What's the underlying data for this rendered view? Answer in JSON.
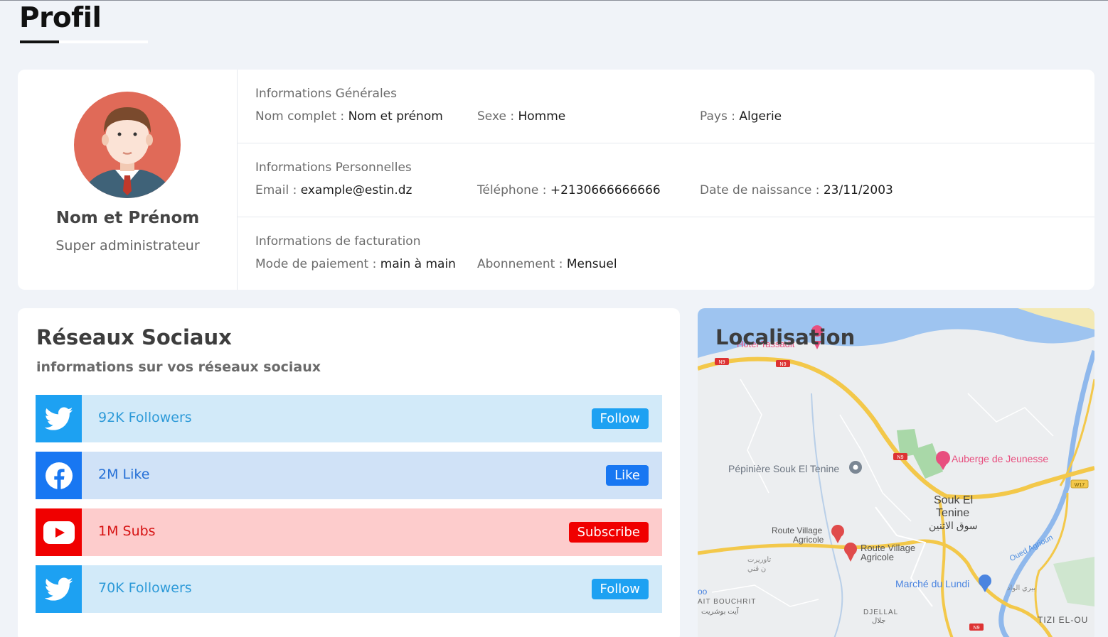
{
  "page": {
    "title": "Profil"
  },
  "profile": {
    "name": "Nom et Prénom",
    "role": "Super administrateur"
  },
  "sections": [
    {
      "heading": "Informations Générales",
      "items": [
        {
          "label": "Nom complet : ",
          "value": "Nom et prénom"
        },
        {
          "label": "Sexe : ",
          "value": "Homme"
        },
        {
          "label": "Pays : ",
          "value": "Algerie"
        }
      ]
    },
    {
      "heading": "Informations Personnelles",
      "items": [
        {
          "label": "Email : ",
          "value": "example@estin.dz"
        },
        {
          "label": "Téléphone : ",
          "value": "+2130666666666"
        },
        {
          "label": "Date de naissance : ",
          "value": "23/11/2003"
        }
      ]
    },
    {
      "heading": "Informations de facturation",
      "items": [
        {
          "label": "Mode de paiement : ",
          "value": "main à main"
        },
        {
          "label": "Abonnement : ",
          "value": "Mensuel"
        }
      ]
    }
  ],
  "social": {
    "title": "Réseaux Sociaux",
    "subtitle": "informations sur vos réseaux sociaux",
    "rows": [
      {
        "network": "twitter",
        "icon": "twitter-icon",
        "count": "92K Followers",
        "button": "Follow",
        "color": "#1da1f2",
        "bg": "#d2eaf9",
        "text_color": "#2d9ad8"
      },
      {
        "network": "facebook",
        "icon": "facebook-icon",
        "count": "2M Like",
        "button": "Like",
        "color": "#1877f2",
        "bg": "#d0e2f7",
        "text_color": "#2670d6"
      },
      {
        "network": "youtube",
        "icon": "youtube-icon",
        "count": "1M Subs",
        "button": "Subscribe",
        "color": "#f00000",
        "bg": "#fdcccc",
        "text_color": "#d61313"
      },
      {
        "network": "twitter",
        "icon": "twitter-icon",
        "count": "70K Followers",
        "button": "Follow",
        "color": "#1da1f2",
        "bg": "#d2eaf9",
        "text_color": "#2d9ad8"
      }
    ]
  },
  "map": {
    "title": "Localisation",
    "labels": {
      "hotel": "Hotel Tassadit",
      "n9_a": "N9",
      "n9_b": "N9",
      "n9_c": "N9",
      "n9_d": "N9",
      "w17": "W17",
      "auberge": "Auberge de Jeunesse",
      "pepiniere": "Pépinière Souk El Tenine",
      "souk_line1": "Souk El",
      "souk_line2": "Tenine",
      "souk_arabic": "سوق الاثنين",
      "route1_line1": "Route Village",
      "route1_line2": "Agricole",
      "route2_line1": "Route Village",
      "route2_line2": "Agricole",
      "oued": "Oued Agrioun",
      "marche": "Marché du Lundi",
      "ait_bouchrit": "AIT BOUCHRIT",
      "ait_bouchrit_ar": "آيت بوشريت",
      "djellal": "DJELLAL",
      "djellal_ar": "جلال",
      "tizi": "TIZI EL-OU",
      "bou": "oo",
      "ar1": "تاوريرت",
      "ar2": "ن ڤني",
      "ar3": "بيري الواد"
    }
  }
}
